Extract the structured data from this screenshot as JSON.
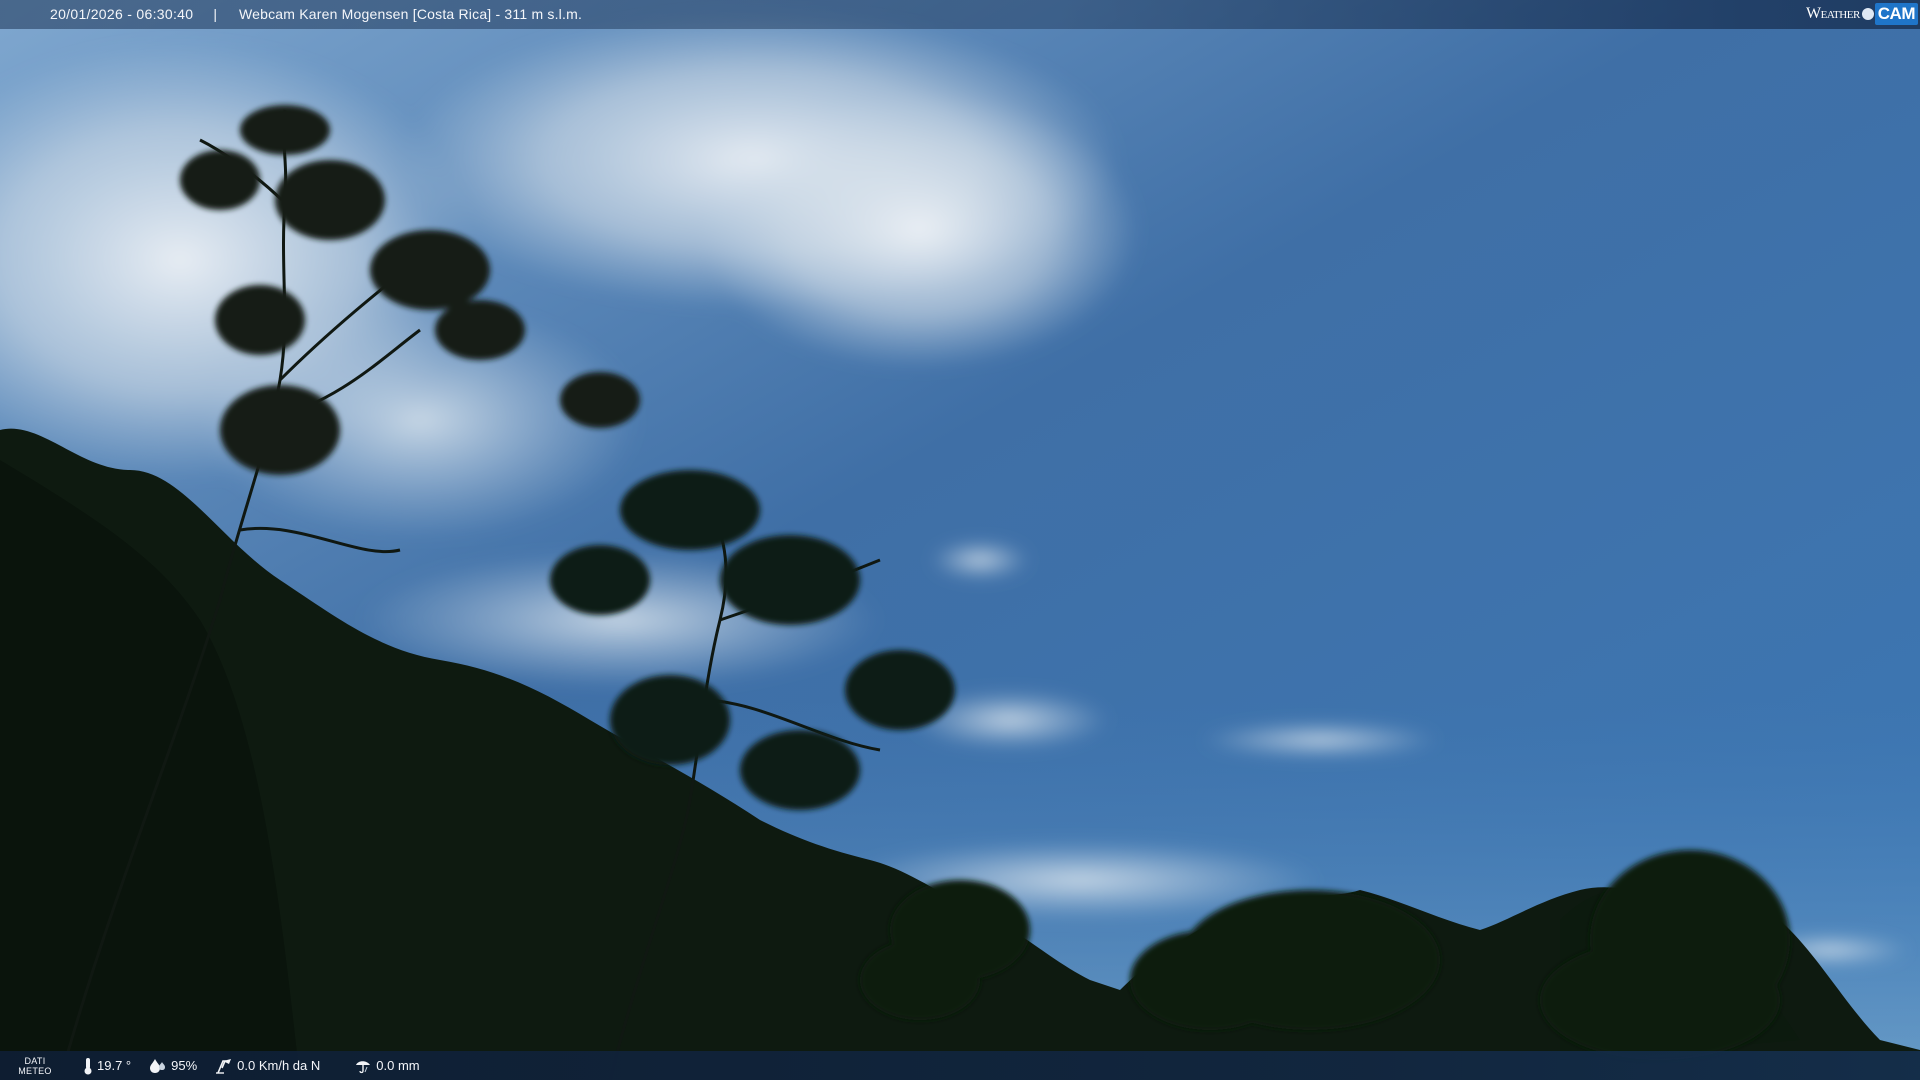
{
  "header": {
    "datetime": "20/01/2026 - 06:30:40",
    "separator": "|",
    "camera_title": "Webcam Karen Mogensen [Costa Rica]  - 311 m s.l.m.",
    "brand_weather": "Weather",
    "brand_cam": "CAM"
  },
  "footer": {
    "data_label_line1": "DATI",
    "data_label_line2": "METEO",
    "temperature": "19.7 °",
    "humidity": "95%",
    "wind": "0.0 Km/h da N",
    "rain": "0.0 mm",
    "icons": [
      "thermometer-icon",
      "humidity-drop-icon",
      "wind-icon",
      "rain-icon"
    ]
  },
  "colors": {
    "sky_top": "#315c93",
    "sky_bottom": "#4f86c0",
    "cloud": "#e8eef5",
    "foliage": "#0d1a0f",
    "accent": "#1f75c9"
  }
}
